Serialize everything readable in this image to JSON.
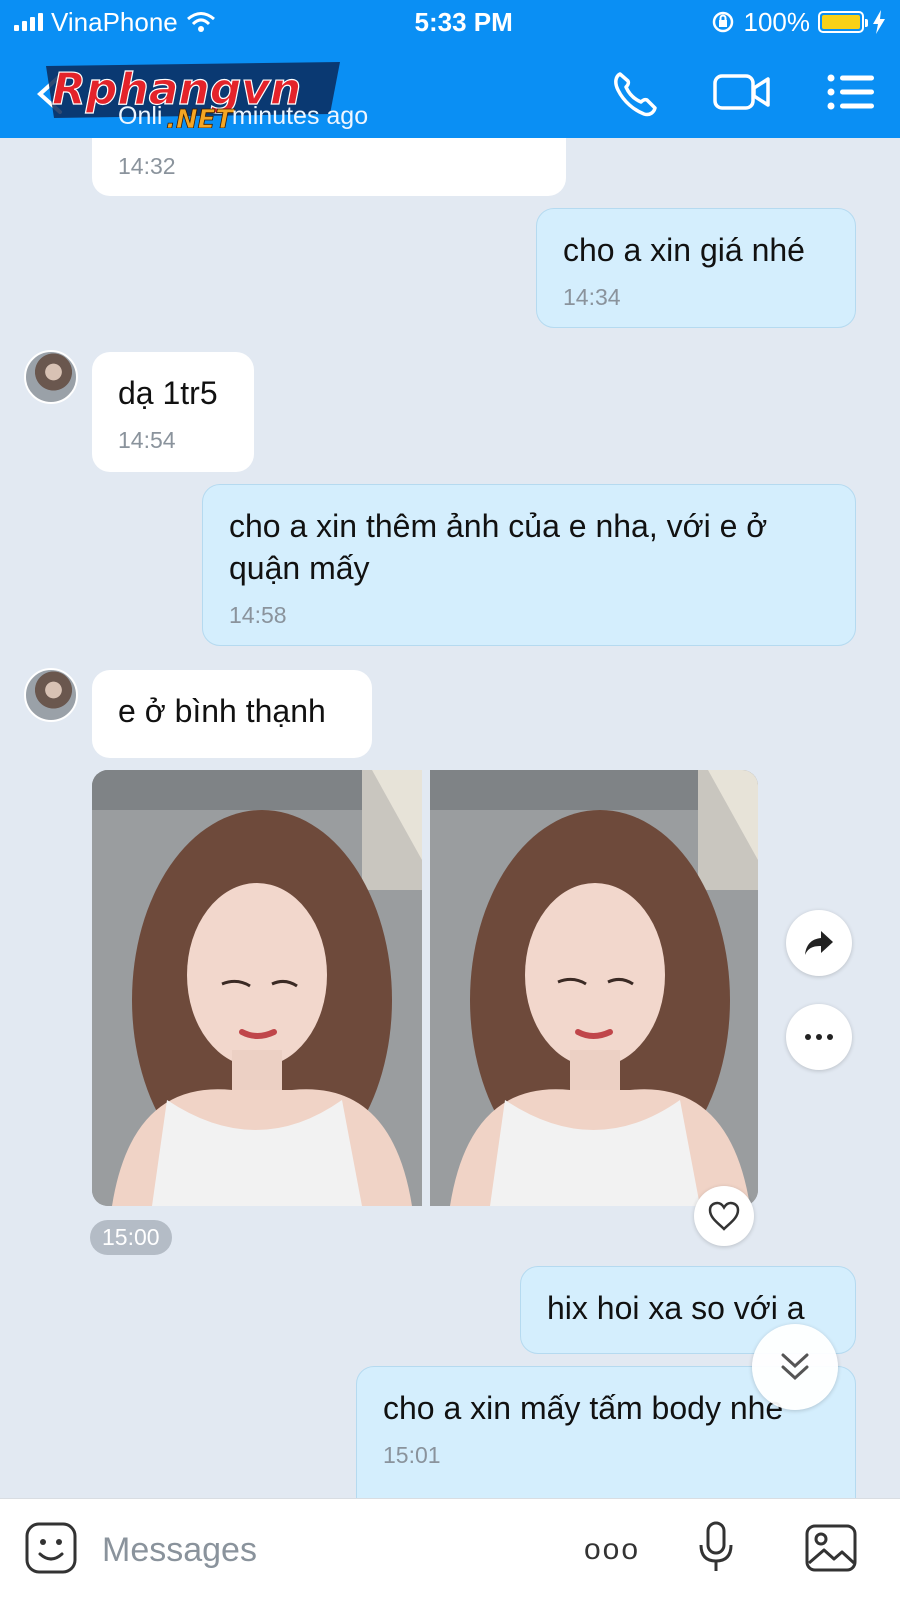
{
  "status_bar": {
    "carrier": "VinaPhone",
    "time": "5:33 PM",
    "battery": "100%"
  },
  "header": {
    "watermark": "Rphangvn",
    "watermark_sub": ".NET",
    "presence": "Onli          minutes ago"
  },
  "messages": {
    "m1": {
      "time": "14:32"
    },
    "m2": {
      "text": "cho a xin giá nhé",
      "time": "14:34"
    },
    "m3": {
      "text": "dạ 1tr5",
      "time": "14:54"
    },
    "m4": {
      "text": "cho a xin thêm ảnh của e nha, với e ở quận mấy",
      "time": "14:58"
    },
    "m5": {
      "text": "e ở bình thạnh"
    },
    "photo_time": "15:00",
    "m6": {
      "text": "hix hoi xa so với a"
    },
    "m7": {
      "text": "cho a xin mấy tấm body nhe",
      "time": "15:01"
    }
  },
  "composer": {
    "placeholder": "Messages",
    "more_label": "ooo"
  },
  "colors": {
    "header": "#0a8ff4",
    "incoming_bubble": "#ffffff",
    "outgoing_bubble": "#d4eefd",
    "chat_background": "#e2e9f2"
  },
  "icons": [
    "back-icon",
    "wifi-icon",
    "lock-rotation-icon",
    "battery-icon",
    "phone-icon",
    "video-icon",
    "menu-icon",
    "forward-icon",
    "more-icon",
    "heart-icon",
    "scroll-down-icon",
    "sticker-icon",
    "mic-icon",
    "image-icon"
  ]
}
